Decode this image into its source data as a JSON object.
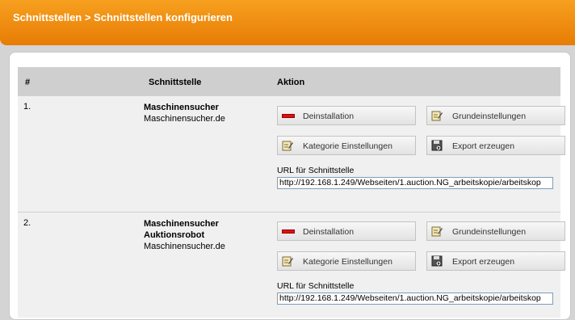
{
  "header": {
    "breadcrumb": "Schnittstellen > Schnittstellen konfigurieren"
  },
  "table": {
    "columns": [
      "#",
      "Schnittstelle",
      "Aktion"
    ],
    "rows": [
      {
        "number": "1.",
        "name_lines": [
          "Maschinensucher"
        ],
        "domain": "Maschinensucher.de",
        "buttons": {
          "uninstall": "Deinstallation",
          "basic_settings": "Grundeinstellungen",
          "category_settings": "Kategorie Einstellungen",
          "export": "Export erzeugen"
        },
        "url_label": "URL für Schnittstelle",
        "url_value": "http://192.168.1.249/Webseiten/1.auction.NG_arbeitskopie/arbeitskop"
      },
      {
        "number": "2.",
        "name_lines": [
          "Maschinensucher",
          "Auktionsrobot"
        ],
        "domain": "Maschinensucher.de",
        "buttons": {
          "uninstall": "Deinstallation",
          "basic_settings": "Grundeinstellungen",
          "category_settings": "Kategorie Einstellungen",
          "export": "Export erzeugen"
        },
        "url_label": "URL für Schnittstelle",
        "url_value": "http://192.168.1.249/Webseiten/1.auction.NG_arbeitskopie/arbeitskop"
      }
    ]
  },
  "icons": {
    "uninstall": "minus-red-icon",
    "settings": "edit-note-icon",
    "export": "disk-export-icon"
  }
}
